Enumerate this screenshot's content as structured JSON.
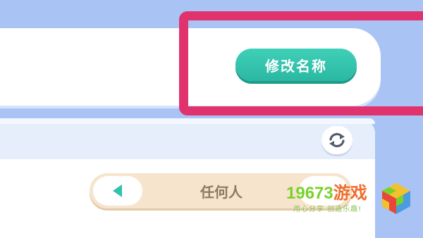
{
  "profile": {
    "rename_label": "修改名称"
  },
  "list_panel": {
    "refresh_icon": "refresh-icon"
  },
  "visibility_selector": {
    "value": "任何人",
    "prev_icon": "triangle-left-icon"
  },
  "watermark": {
    "number": "19673",
    "brand": "游戏",
    "slogan": "用心分享 创造乐趣!"
  },
  "colors": {
    "accent": "#2bb8a2",
    "highlight": "#e0336e",
    "background": "#a9c4f4"
  }
}
